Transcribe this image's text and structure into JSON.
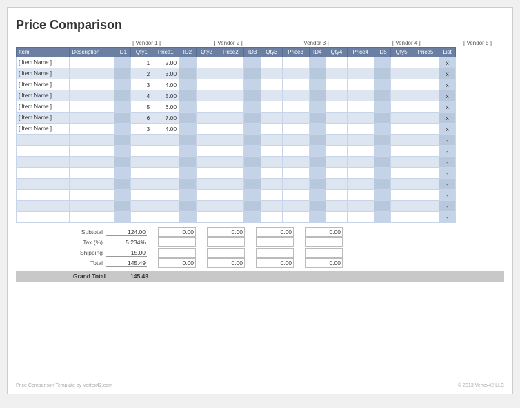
{
  "title": "Price Comparison",
  "vendors": [
    {
      "label": "[ Vendor 1 ]",
      "colspan": 3
    },
    {
      "label": "[ Vendor 2 ]",
      "colspan": 3
    },
    {
      "label": "[ Vendor 3 ]",
      "colspan": 3
    },
    {
      "label": "[ Vendor 4 ]",
      "colspan": 3
    },
    {
      "label": "[ Vendor 5 ]",
      "colspan": 3
    }
  ],
  "column_headers": [
    "Item",
    "Description",
    "ID1",
    "Qty1",
    "Price1",
    "ID2",
    "Qty2",
    "Price2",
    "ID3",
    "Qty3",
    "Price3",
    "ID4",
    "Qty4",
    "Price4",
    "ID5",
    "Qty5",
    "Price5",
    "List"
  ],
  "items": [
    {
      "name": "[ Item Name ]",
      "desc": "",
      "id1": "",
      "qty1": "1",
      "price1": "2.00",
      "id2": "",
      "qty2": "",
      "price2": "",
      "id3": "",
      "qty3": "",
      "price3": "",
      "id4": "",
      "qty4": "",
      "price4": "",
      "id5": "",
      "qty5": "",
      "price5": "",
      "list": "x"
    },
    {
      "name": "[ Item Name ]",
      "desc": "",
      "id1": "",
      "qty1": "2",
      "price1": "3.00",
      "id2": "",
      "qty2": "",
      "price2": "",
      "id3": "",
      "qty3": "",
      "price3": "",
      "id4": "",
      "qty4": "",
      "price4": "",
      "id5": "",
      "qty5": "",
      "price5": "",
      "list": "x"
    },
    {
      "name": "[ Item Name ]",
      "desc": "",
      "id1": "",
      "qty1": "3",
      "price1": "4.00",
      "id2": "",
      "qty2": "",
      "price2": "",
      "id3": "",
      "qty3": "",
      "price3": "",
      "id4": "",
      "qty4": "",
      "price4": "",
      "id5": "",
      "qty5": "",
      "price5": "",
      "list": "x"
    },
    {
      "name": "[ Item Name ]",
      "desc": "",
      "id1": "",
      "qty1": "4",
      "price1": "5.00",
      "id2": "",
      "qty2": "",
      "price2": "",
      "id3": "",
      "qty3": "",
      "price3": "",
      "id4": "",
      "qty4": "",
      "price4": "",
      "id5": "",
      "qty5": "",
      "price5": "",
      "list": "x"
    },
    {
      "name": "[ Item Name ]",
      "desc": "",
      "id1": "",
      "qty1": "5",
      "price1": "6.00",
      "id2": "",
      "qty2": "",
      "price2": "",
      "id3": "",
      "qty3": "",
      "price3": "",
      "id4": "",
      "qty4": "",
      "price4": "",
      "id5": "",
      "qty5": "",
      "price5": "",
      "list": "x"
    },
    {
      "name": "[ Item Name ]",
      "desc": "",
      "id1": "",
      "qty1": "6",
      "price1": "7.00",
      "id2": "",
      "qty2": "",
      "price2": "",
      "id3": "",
      "qty3": "",
      "price3": "",
      "id4": "",
      "qty4": "",
      "price4": "",
      "id5": "",
      "qty5": "",
      "price5": "",
      "list": "x"
    },
    {
      "name": "[ Item Name ]",
      "desc": "",
      "id1": "",
      "qty1": "3",
      "price1": "4.00",
      "id2": "",
      "qty2": "",
      "price2": "",
      "id3": "",
      "qty3": "",
      "price3": "",
      "id4": "",
      "qty4": "",
      "price4": "",
      "id5": "",
      "qty5": "",
      "price5": "",
      "list": "x"
    },
    {
      "name": "",
      "desc": "",
      "id1": "",
      "qty1": "",
      "price1": "",
      "id2": "",
      "qty2": "",
      "price2": "",
      "id3": "",
      "qty3": "",
      "price3": "",
      "id4": "",
      "qty4": "",
      "price4": "",
      "id5": "",
      "qty5": "",
      "price5": "",
      "list": "-"
    },
    {
      "name": "",
      "desc": "",
      "id1": "",
      "qty1": "",
      "price1": "",
      "id2": "",
      "qty2": "",
      "price2": "",
      "id3": "",
      "qty3": "",
      "price3": "",
      "id4": "",
      "qty4": "",
      "price4": "",
      "id5": "",
      "qty5": "",
      "price5": "",
      "list": "-"
    },
    {
      "name": "",
      "desc": "",
      "id1": "",
      "qty1": "",
      "price1": "",
      "id2": "",
      "qty2": "",
      "price2": "",
      "id3": "",
      "qty3": "",
      "price3": "",
      "id4": "",
      "qty4": "",
      "price4": "",
      "id5": "",
      "qty5": "",
      "price5": "",
      "list": "-"
    },
    {
      "name": "",
      "desc": "",
      "id1": "",
      "qty1": "",
      "price1": "",
      "id2": "",
      "qty2": "",
      "price2": "",
      "id3": "",
      "qty3": "",
      "price3": "",
      "id4": "",
      "qty4": "",
      "price4": "",
      "id5": "",
      "qty5": "",
      "price5": "",
      "list": "-"
    },
    {
      "name": "",
      "desc": "",
      "id1": "",
      "qty1": "",
      "price1": "",
      "id2": "",
      "qty2": "",
      "price2": "",
      "id3": "",
      "qty3": "",
      "price3": "",
      "id4": "",
      "qty4": "",
      "price4": "",
      "id5": "",
      "qty5": "",
      "price5": "",
      "list": "-"
    },
    {
      "name": "",
      "desc": "",
      "id1": "",
      "qty1": "",
      "price1": "",
      "id2": "",
      "qty2": "",
      "price2": "",
      "id3": "",
      "qty3": "",
      "price3": "",
      "id4": "",
      "qty4": "",
      "price4": "",
      "id5": "",
      "qty5": "",
      "price5": "",
      "list": "-"
    },
    {
      "name": "",
      "desc": "",
      "id1": "",
      "qty1": "",
      "price1": "",
      "id2": "",
      "qty2": "",
      "price2": "",
      "id3": "",
      "qty3": "",
      "price3": "",
      "id4": "",
      "qty4": "",
      "price4": "",
      "id5": "",
      "qty5": "",
      "price5": "",
      "list": "-"
    },
    {
      "name": "",
      "desc": "",
      "id1": "",
      "qty1": "",
      "price1": "",
      "id2": "",
      "qty2": "",
      "price2": "",
      "id3": "",
      "qty3": "",
      "price3": "",
      "id4": "",
      "qty4": "",
      "price4": "",
      "id5": "",
      "qty5": "",
      "price5": "",
      "list": "-"
    }
  ],
  "summary": {
    "subtotal_label": "Subtotal",
    "subtotal_v1": "124.00",
    "subtotal_v2": "0.00",
    "subtotal_v3": "0.00",
    "subtotal_v4": "0.00",
    "subtotal_v5": "0.00",
    "tax_label": "Tax (%)",
    "tax_v1": "5.234%",
    "shipping_label": "Shipping",
    "shipping_v1": "15.00",
    "total_label": "Total",
    "total_v1": "145.49",
    "total_v2": "0.00",
    "total_v3": "0.00",
    "total_v4": "0.00",
    "total_v5": "0.00",
    "grand_total_label": "Grand Total",
    "grand_total_value": "145.49"
  },
  "footer_left": "Price Comparison Template by Vertex42.com",
  "footer_right": "© 2013 Vertex42 LLC"
}
